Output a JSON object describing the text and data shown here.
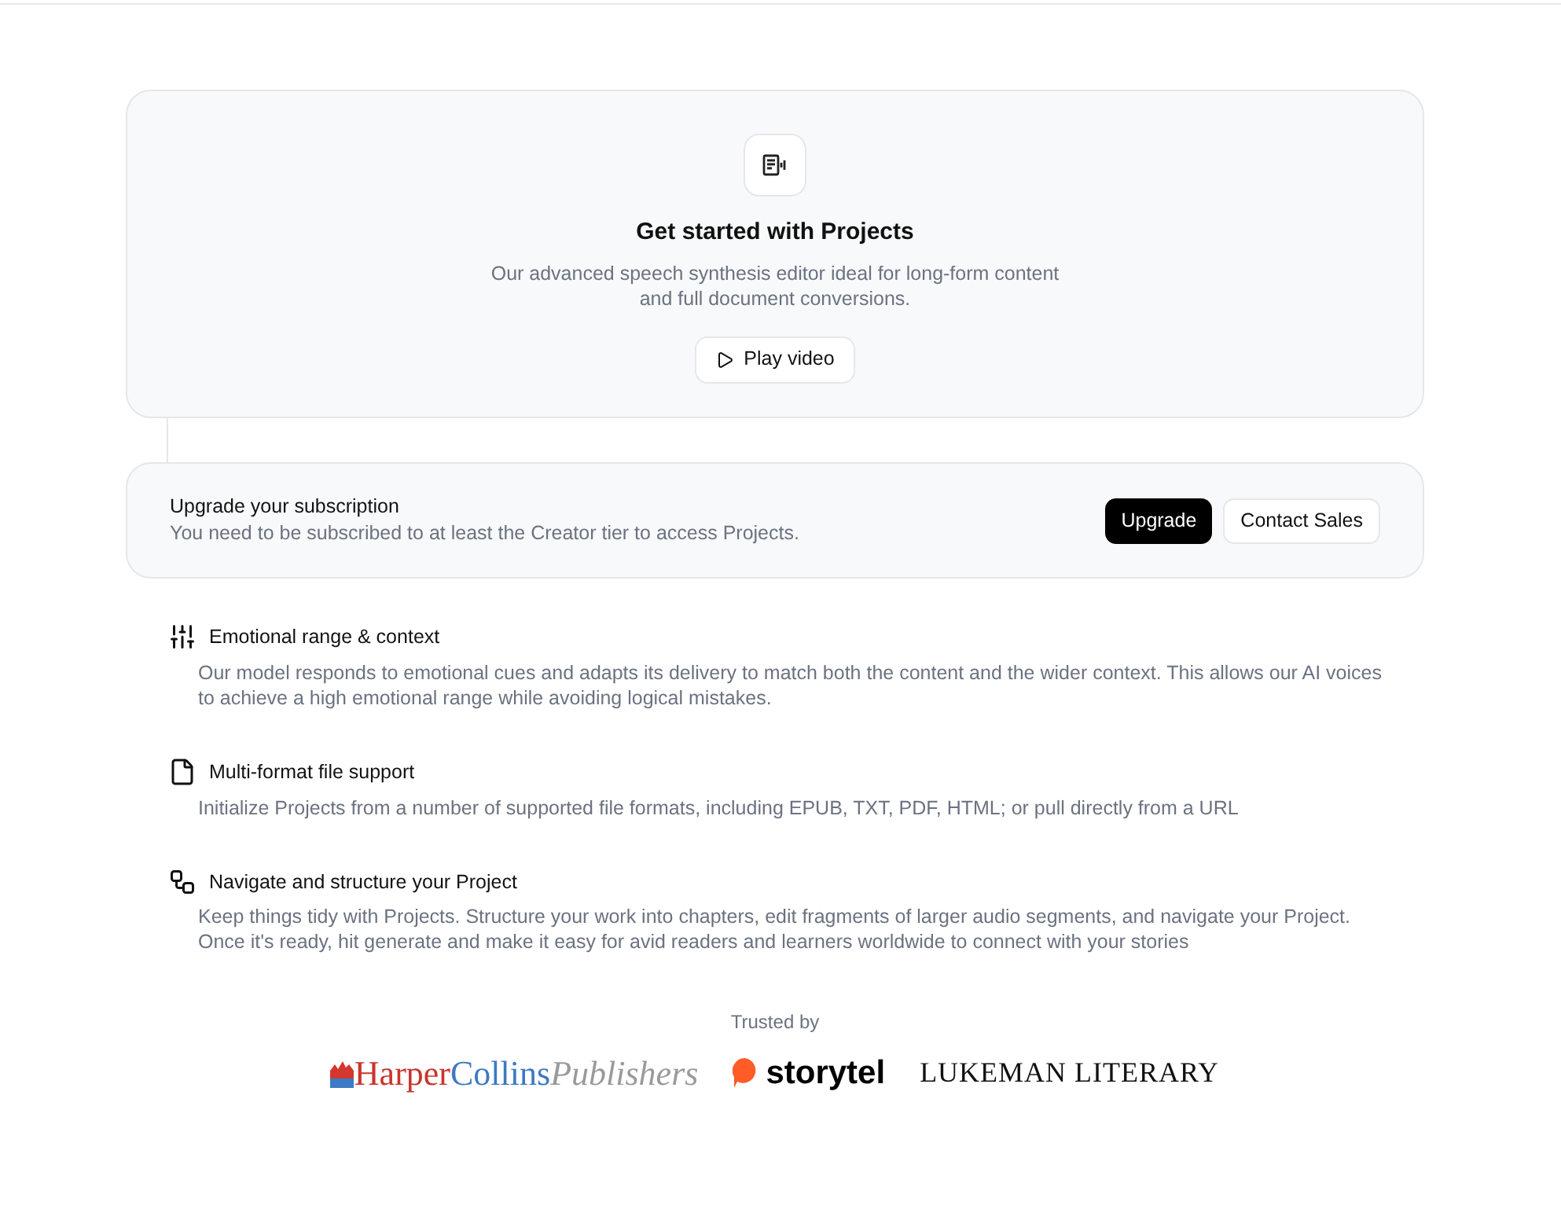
{
  "hero": {
    "title": "Get started with Projects",
    "description": "Our advanced speech synthesis editor ideal for long-form content and full document conversions.",
    "button": "Play video"
  },
  "upgrade": {
    "title": "Upgrade your subscription",
    "description": "You need to be subscribed to at least the Creator tier to access Projects.",
    "buttons": [
      {
        "label": "Upgrade",
        "kind": "primary"
      },
      {
        "label": "Contact Sales",
        "kind": "secondary"
      }
    ]
  },
  "features": [
    {
      "kind": "sliders",
      "title": "Emotional range & context",
      "description": "Our model responds to emotional cues and adapts its delivery to match both the content and the wider context. This allows our AI voices to achieve a high emotional range while avoiding logical mistakes."
    },
    {
      "kind": "file",
      "title": "Multi-format file support",
      "description": "Initialize Projects from a number of supported file formats, including EPUB, TXT, PDF, HTML; or pull directly from a URL"
    },
    {
      "kind": "structure",
      "title": "Navigate and structure your Project",
      "description": "Keep things tidy with Projects. Structure your work into chapters, edit fragments of larger audio segments, and navigate your Project. Once it's ready, hit generate and make it easy for avid readers and learners worldwide to connect with your stories"
    }
  ],
  "trusted": {
    "label": "Trusted by",
    "logos": [
      {
        "kind": "harpercollins",
        "parts": [
          "Harper",
          "Collins",
          "Publishers"
        ]
      },
      {
        "kind": "storytel",
        "parts": [
          "storytel"
        ]
      },
      {
        "kind": "lukeman",
        "parts": [
          "LUKEMAN LITERARY"
        ]
      }
    ]
  }
}
